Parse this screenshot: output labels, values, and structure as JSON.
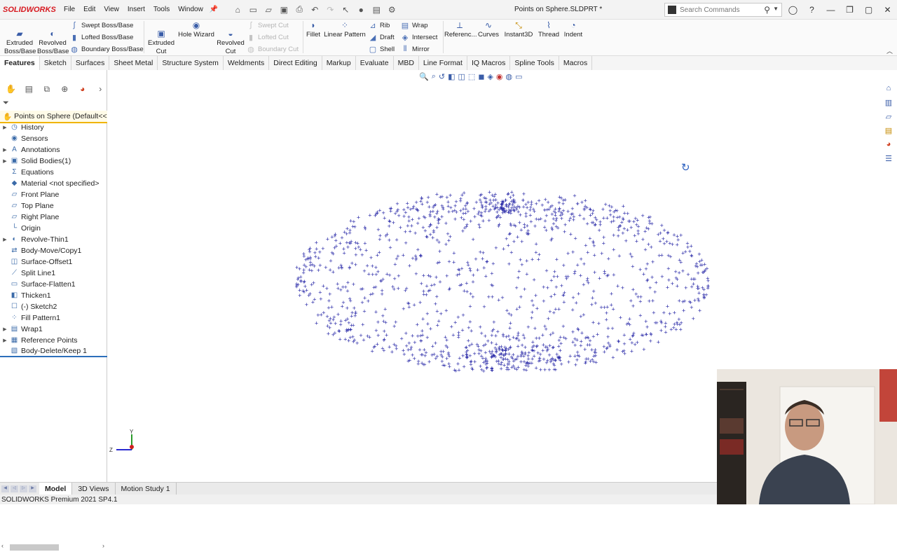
{
  "app": {
    "brand": "SOLIDWORKS",
    "document_title": "Points on Sphere.SLDPRT *",
    "menus": [
      "File",
      "Edit",
      "View",
      "Insert",
      "Tools",
      "Window"
    ],
    "search_placeholder": "Search Commands"
  },
  "command_manager": {
    "extruded_boss": "Extruded\nBoss/Base",
    "revolved_boss": "Revolved\nBoss/Base",
    "swept_boss": "Swept Boss/Base",
    "lofted_boss": "Lofted Boss/Base",
    "boundary_boss": "Boundary Boss/Base",
    "extruded_cut": "Extruded\nCut",
    "hole_wizard": "Hole Wizard",
    "revolved_cut": "Revolved\nCut",
    "swept_cut": "Swept Cut",
    "lofted_cut": "Lofted Cut",
    "boundary_cut": "Boundary Cut",
    "fillet": "Fillet",
    "linear_pattern": "Linear Pattern",
    "rib": "Rib",
    "draft": "Draft",
    "shell": "Shell",
    "wrap": "Wrap",
    "intersect": "Intersect",
    "mirror": "Mirror",
    "reference": "Referenc...",
    "curves": "Curves",
    "instant3d": "Instant3D",
    "thread": "Thread",
    "indent": "Indent"
  },
  "tabs": [
    "Features",
    "Sketch",
    "Surfaces",
    "Sheet Metal",
    "Structure System",
    "Weldments",
    "Direct Editing",
    "Markup",
    "Evaluate",
    "MBD",
    "Line Format",
    "IQ Macros",
    "Spline Tools",
    "Macros"
  ],
  "tree": {
    "root": "Points on Sphere  (Default<<D",
    "items": [
      {
        "label": "History",
        "icon": "history-icon",
        "exp": true
      },
      {
        "label": "Sensors",
        "icon": "sensor-icon",
        "exp": false
      },
      {
        "label": "Annotations",
        "icon": "annotation-icon",
        "exp": true
      },
      {
        "label": "Solid Bodies(1)",
        "icon": "solid-bodies-icon",
        "exp": true
      },
      {
        "label": "Equations",
        "icon": "equations-icon",
        "exp": false
      },
      {
        "label": "Material <not specified>",
        "icon": "material-icon",
        "exp": false
      },
      {
        "label": "Front Plane",
        "icon": "plane-icon",
        "exp": false
      },
      {
        "label": "Top Plane",
        "icon": "plane-icon",
        "exp": false
      },
      {
        "label": "Right Plane",
        "icon": "plane-icon",
        "exp": false
      },
      {
        "label": "Origin",
        "icon": "origin-icon",
        "exp": false
      },
      {
        "label": "Revolve-Thin1",
        "icon": "revolve-icon",
        "exp": true
      },
      {
        "label": "Body-Move/Copy1",
        "icon": "move-copy-icon",
        "exp": false
      },
      {
        "label": "Surface-Offset1",
        "icon": "surface-offset-icon",
        "exp": false
      },
      {
        "label": "Split Line1",
        "icon": "split-line-icon",
        "exp": false
      },
      {
        "label": "Surface-Flatten1",
        "icon": "surface-flatten-icon",
        "exp": false
      },
      {
        "label": "Thicken1",
        "icon": "thicken-icon",
        "exp": false
      },
      {
        "label": "(-) Sketch2",
        "icon": "sketch-icon",
        "exp": false
      },
      {
        "label": "Fill Pattern1",
        "icon": "fill-pattern-icon",
        "exp": false
      },
      {
        "label": "Wrap1",
        "icon": "wrap-icon",
        "exp": true
      },
      {
        "label": "Reference Points",
        "icon": "folder-icon",
        "exp": true
      },
      {
        "label": "Body-Delete/Keep 1",
        "icon": "body-delete-icon",
        "exp": false
      }
    ]
  },
  "bottom_tabs": [
    "Model",
    "3D Views",
    "Motion Study 1"
  ],
  "status": "SOLIDWORKS Premium 2021 SP4.1",
  "axis_labels": {
    "y": "Y",
    "z": "Z"
  },
  "colors": {
    "points": "#2a2aa8",
    "accent": "#d71920",
    "selection": "#f0b400"
  }
}
